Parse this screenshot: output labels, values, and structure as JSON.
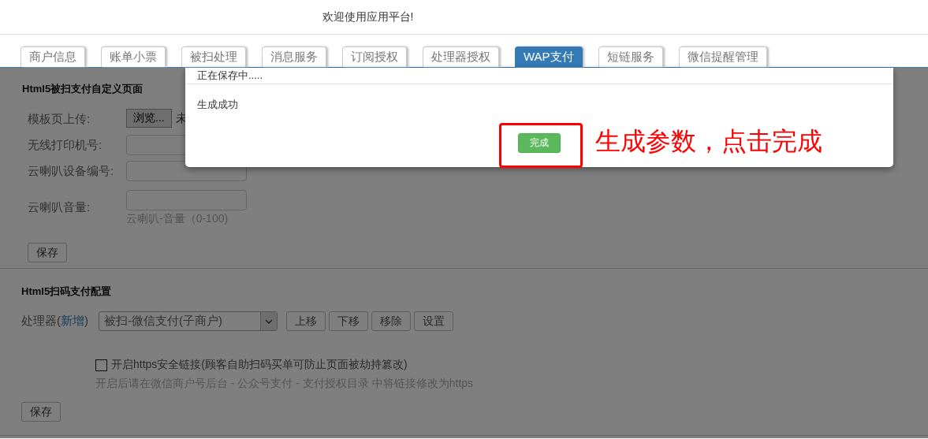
{
  "header": {
    "welcome": "欢迎使用应用平台!"
  },
  "tabs": [
    {
      "label": "商户信息",
      "selected": false
    },
    {
      "label": "账单小票",
      "selected": false
    },
    {
      "label": "被扫处理",
      "selected": false
    },
    {
      "label": "消息服务",
      "selected": false
    },
    {
      "label": "订阅授权",
      "selected": false
    },
    {
      "label": "处理器授权",
      "selected": false
    },
    {
      "label": "WAP支付",
      "selected": true
    },
    {
      "label": "短链服务",
      "selected": false
    },
    {
      "label": "微信提醒管理",
      "selected": false
    }
  ],
  "custom_page": {
    "title": "Html5被扫支付自定义页面",
    "upload_label": "模板页上传:",
    "browse_button": "浏览...",
    "file_status": "未",
    "fields": [
      {
        "label": "无线打印机号:"
      },
      {
        "label": "云喇叭设备编号:"
      },
      {
        "label": "云喇叭音量:",
        "hint": "云喇叭-音量（0-100)"
      }
    ],
    "save_button": "保存"
  },
  "scan_config": {
    "title": "Html5扫码支付配置",
    "processor_label": "处理器(",
    "add_link": "新增",
    "processor_label_end": ")",
    "processor_value": "被扫-微信支付(子商户)",
    "buttons": [
      "上移",
      "下移",
      "移除",
      "设置"
    ],
    "https": {
      "label": "开启https安全链接(顾客自助扫码买单可防止页面被劫持篡改)",
      "checked": false
    },
    "hint": "开启后请在微信商户号后台 - 公众号支付 - 支付授权目录 中将链接修改为https",
    "save_button": "保存"
  },
  "dialog": {
    "title": "正在保存中.....",
    "message": "生成成功",
    "done_button": "完成"
  },
  "annotation": {
    "text": "生成参数，点击完成"
  }
}
